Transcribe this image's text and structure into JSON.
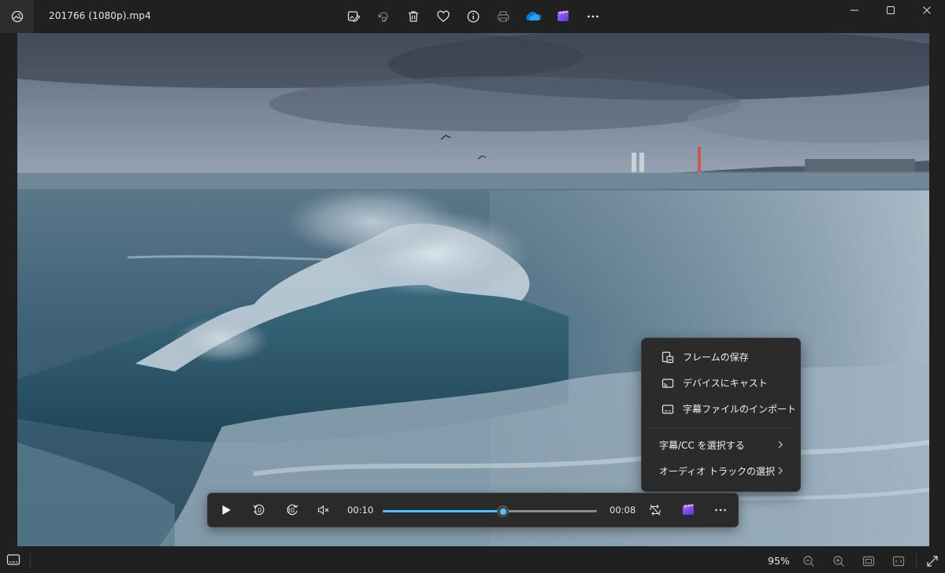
{
  "window": {
    "file_name": "201766 (1080p).mp4"
  },
  "toolbar": {
    "buttons": [
      {
        "name": "edit-image-icon"
      },
      {
        "name": "rotate-icon"
      },
      {
        "name": "delete-icon"
      },
      {
        "name": "favorite-heart-icon"
      },
      {
        "name": "info-icon"
      },
      {
        "name": "print-icon"
      },
      {
        "name": "onedrive-cloud-icon"
      },
      {
        "name": "clipchamp-icon"
      },
      {
        "name": "more-options-icon"
      }
    ]
  },
  "context_menu": {
    "items": [
      {
        "label": "フレームの保存",
        "icon": "save-frame-icon"
      },
      {
        "label": "デバイスにキャスト",
        "icon": "cast-icon"
      },
      {
        "label": "字幕ファイルのインポート",
        "icon": "subtitle-icon"
      },
      {
        "label": "字幕/CC を選択する",
        "submenu": true
      },
      {
        "label": "オーディオ トラックの選択",
        "submenu": true
      }
    ]
  },
  "player": {
    "elapsed": "00:10",
    "remaining": "00:08",
    "progress": 0.56,
    "muted": true,
    "skip_back_seconds": "10",
    "skip_forward_seconds": "30"
  },
  "statusbar": {
    "zoom": "95%"
  },
  "colors": {
    "accent": "#4cc2ff",
    "background": "#202020",
    "panel": "#2b2b2b"
  }
}
